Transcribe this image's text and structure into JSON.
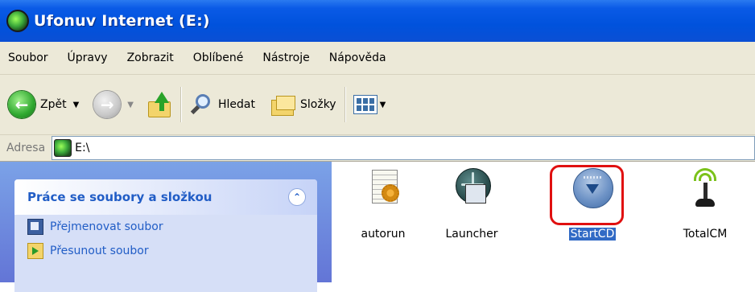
{
  "window": {
    "title": "Ufonuv Internet (E:)"
  },
  "menu": [
    "Soubor",
    "Úpravy",
    "Zobrazit",
    "Oblíbené",
    "Nástroje",
    "Nápověda"
  ],
  "toolbar": {
    "back_label": "Zpět",
    "search_label": "Hledat",
    "folders_label": "Složky"
  },
  "address": {
    "label": "Adresa",
    "value": "E:\\"
  },
  "taskpane": {
    "title": "Práce se soubory a složkou",
    "tasks": [
      "Přejmenovat soubor",
      "Přesunout soubor"
    ]
  },
  "files": [
    {
      "name": "autorun",
      "icon": "autorun-icon",
      "selected": false
    },
    {
      "name": "Launcher",
      "icon": "launcher-icon",
      "selected": false
    },
    {
      "name": "StartCD",
      "icon": "startcd-icon",
      "selected": true
    },
    {
      "name": "TotalCM",
      "icon": "totalcm-icon",
      "selected": false
    }
  ],
  "colors": {
    "titlebar": "#0052dc",
    "selection": "#316ac5",
    "highlight": "#e01010",
    "taskpane_text": "#215dc6"
  }
}
